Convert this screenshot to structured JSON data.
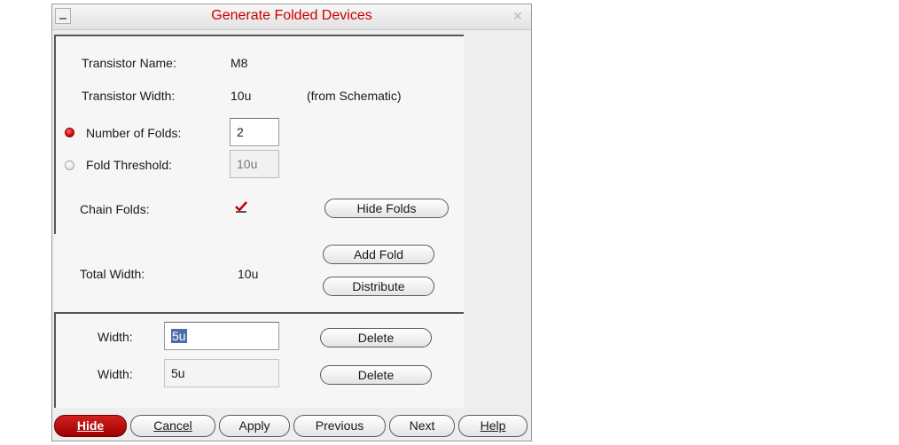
{
  "window": {
    "title": "Generate Folded Devices",
    "close_glyph": "✕"
  },
  "form": {
    "transistor_name_label": "Transistor Name:",
    "transistor_name_value": "M8",
    "transistor_width_label": "Transistor Width:",
    "transistor_width_value": "10u",
    "transistor_width_note": "(from Schematic)",
    "number_of_folds_label": "Number of Folds:",
    "number_of_folds_value": "2",
    "number_of_folds_selected": true,
    "fold_threshold_label": "Fold Threshold:",
    "fold_threshold_value": "10u",
    "fold_threshold_selected": false,
    "chain_folds_label": "Chain Folds:",
    "chain_folds_checked": true,
    "hide_folds_button": "Hide Folds",
    "add_fold_button": "Add Fold",
    "total_width_label": "Total Width:",
    "total_width_value": "10u",
    "distribute_button": "Distribute"
  },
  "folds": [
    {
      "width_label": "Width:",
      "width_value": "5u",
      "delete_button": "Delete"
    },
    {
      "width_label": "Width:",
      "width_value": "5u",
      "delete_button": "Delete"
    }
  ],
  "footer": {
    "hide_button": "Hide",
    "cancel_button": "Cancel",
    "apply_button": "Apply",
    "previous_button": "Previous",
    "next_button": "Next",
    "help_button": "Help"
  },
  "colors": {
    "title": "#cc0000",
    "primary_button": "#b00000",
    "radio_selected": "#cc0000",
    "check_mark": "#cc0000",
    "selection_highlight": "#4a6ea8"
  }
}
